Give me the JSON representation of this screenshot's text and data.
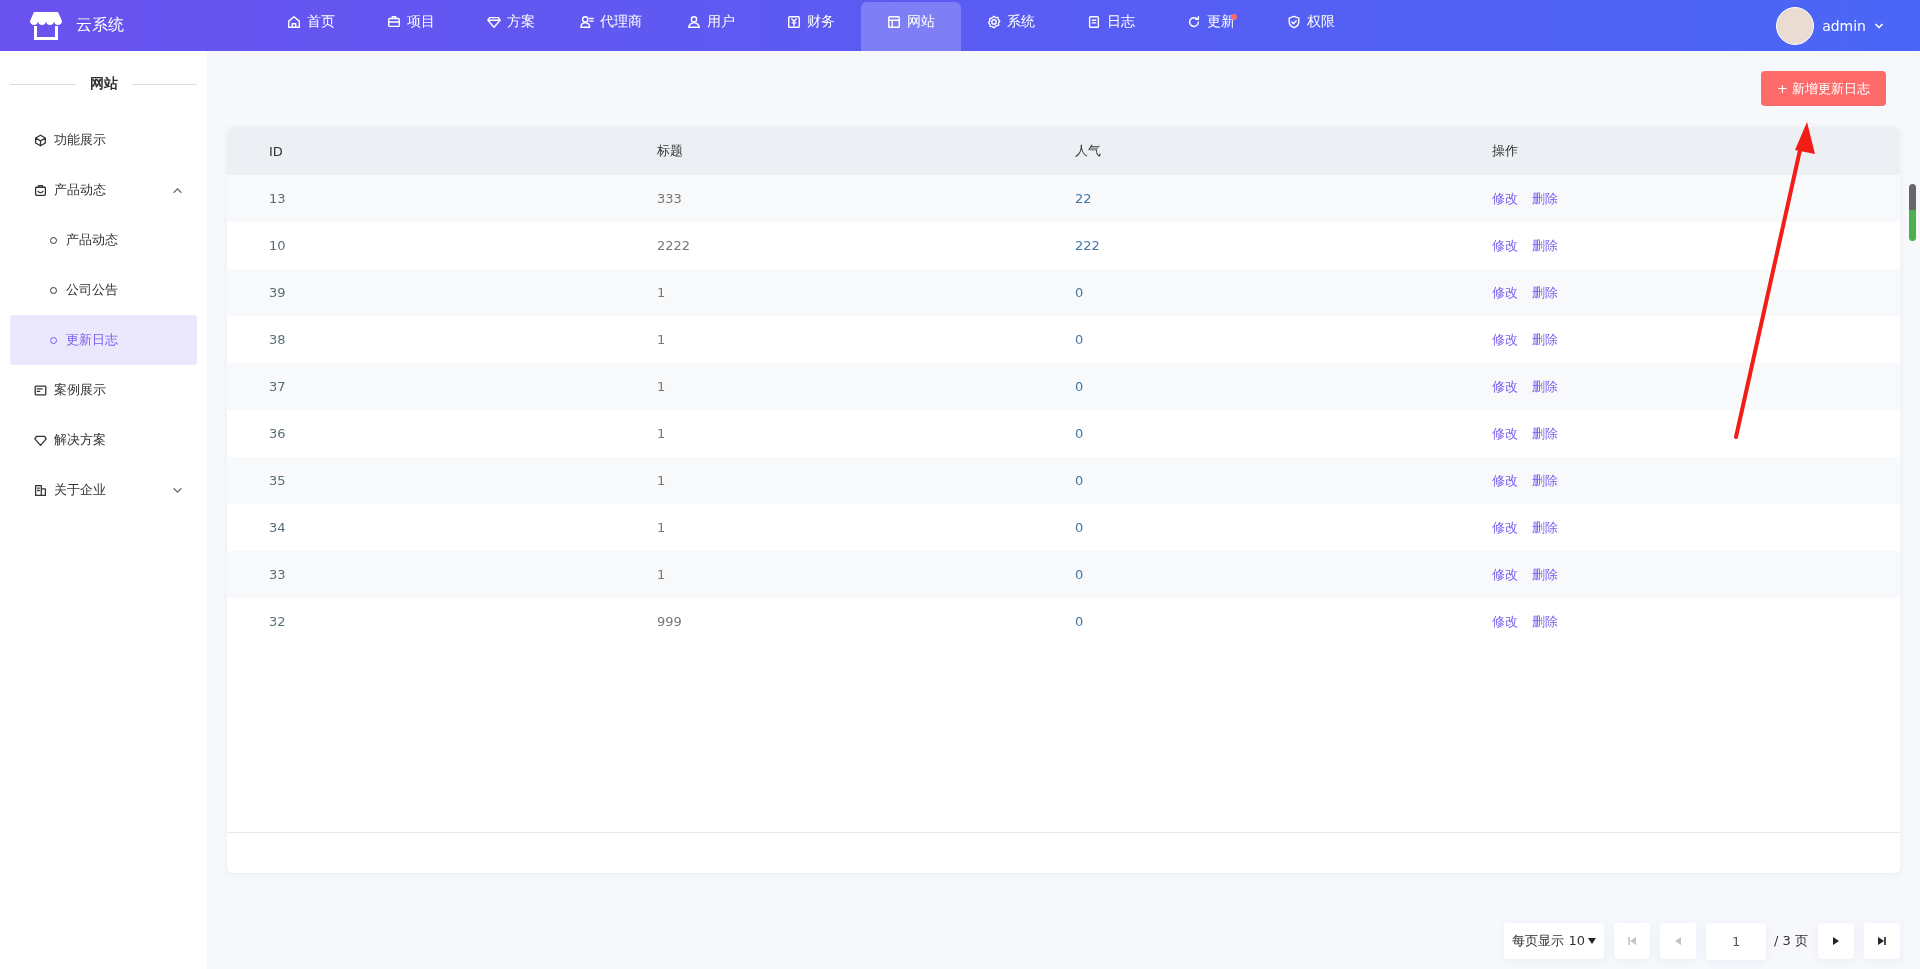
{
  "header": {
    "logo_text": "云系统",
    "nav": [
      {
        "label": "首页",
        "selected": false,
        "dot": false
      },
      {
        "label": "项目",
        "selected": false,
        "dot": false
      },
      {
        "label": "方案",
        "selected": false,
        "dot": false
      },
      {
        "label": "代理商",
        "selected": false,
        "dot": false
      },
      {
        "label": "用户",
        "selected": false,
        "dot": false
      },
      {
        "label": "财务",
        "selected": false,
        "dot": false
      },
      {
        "label": "网站",
        "selected": true,
        "dot": false
      },
      {
        "label": "系统",
        "selected": false,
        "dot": false
      },
      {
        "label": "日志",
        "selected": false,
        "dot": false
      },
      {
        "label": "更新",
        "selected": false,
        "dot": true
      },
      {
        "label": "权限",
        "selected": false,
        "dot": false
      }
    ],
    "user": {
      "name": "admin"
    }
  },
  "sidebar": {
    "title": "网站",
    "items": [
      {
        "label": "功能展示",
        "selected": false
      },
      {
        "label": "产品动态",
        "selected": false,
        "expanded": true,
        "children": [
          {
            "label": "产品动态",
            "selected": false
          },
          {
            "label": "公司公告",
            "selected": false
          },
          {
            "label": "更新日志",
            "selected": true
          }
        ]
      },
      {
        "label": "案例展示",
        "selected": false
      },
      {
        "label": "解决方案",
        "selected": false
      },
      {
        "label": "关于企业",
        "selected": false,
        "expanded": false
      }
    ]
  },
  "toolbar": {
    "add_button": "+ 新增更新日志"
  },
  "table": {
    "columns": [
      "ID",
      "标题",
      "人气",
      "操作"
    ],
    "rows": [
      {
        "id": "13",
        "title": "333",
        "popularity": "22",
        "actions": [
          "修改",
          "删除"
        ]
      },
      {
        "id": "10",
        "title": "2222",
        "popularity": "222",
        "actions": [
          "修改",
          "删除"
        ]
      },
      {
        "id": "39",
        "title": "1",
        "popularity": "0",
        "actions": [
          "修改",
          "删除"
        ]
      },
      {
        "id": "38",
        "title": "1",
        "popularity": "0",
        "actions": [
          "修改",
          "删除"
        ]
      },
      {
        "id": "37",
        "title": "1",
        "popularity": "0",
        "actions": [
          "修改",
          "删除"
        ]
      },
      {
        "id": "36",
        "title": "1",
        "popularity": "0",
        "actions": [
          "修改",
          "删除"
        ]
      },
      {
        "id": "35",
        "title": "1",
        "popularity": "0",
        "actions": [
          "修改",
          "删除"
        ]
      },
      {
        "id": "34",
        "title": "1",
        "popularity": "0",
        "actions": [
          "修改",
          "删除"
        ]
      },
      {
        "id": "33",
        "title": "1",
        "popularity": "0",
        "actions": [
          "修改",
          "删除"
        ]
      },
      {
        "id": "32",
        "title": "999",
        "popularity": "0",
        "actions": [
          "修改",
          "删除"
        ]
      }
    ]
  },
  "pagination": {
    "page_size": "每页显示 10",
    "page": "1",
    "total": "/ 3 页",
    "buttons": [
      {
        "kind": "first",
        "disabled": true
      },
      {
        "kind": "prev",
        "disabled": true
      },
      {
        "kind": "next",
        "disabled": false
      },
      {
        "kind": "last",
        "disabled": false
      }
    ]
  }
}
